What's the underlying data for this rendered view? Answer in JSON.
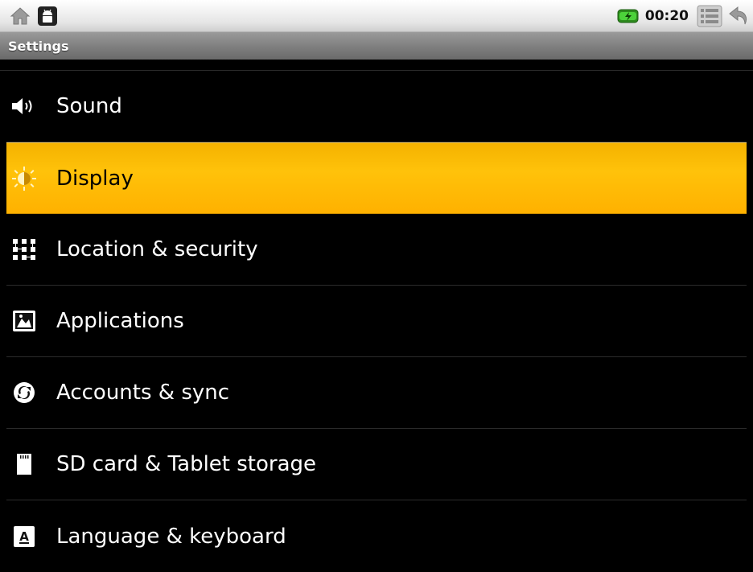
{
  "status_bar": {
    "time": "00:20",
    "left_icons": [
      "home-icon",
      "android-debug-icon"
    ],
    "right_icons": [
      "battery-charging-icon",
      "menu-icon",
      "back-icon"
    ]
  },
  "title_bar": {
    "title": "Settings"
  },
  "settings": {
    "items": [
      {
        "label": "Sound",
        "icon": "speaker-icon"
      },
      {
        "label": "Display",
        "icon": "brightness-icon",
        "selected": true
      },
      {
        "label": "Location & security",
        "icon": "location-security-icon"
      },
      {
        "label": "Applications",
        "icon": "applications-icon"
      },
      {
        "label": "Accounts & sync",
        "icon": "sync-icon"
      },
      {
        "label": "SD card & Tablet storage",
        "icon": "sd-card-icon"
      },
      {
        "label": "Language & keyboard",
        "icon": "keyboard-icon"
      }
    ]
  },
  "colors": {
    "selection": "#ffb800",
    "background": "#000000",
    "title_bar": "#808080"
  }
}
